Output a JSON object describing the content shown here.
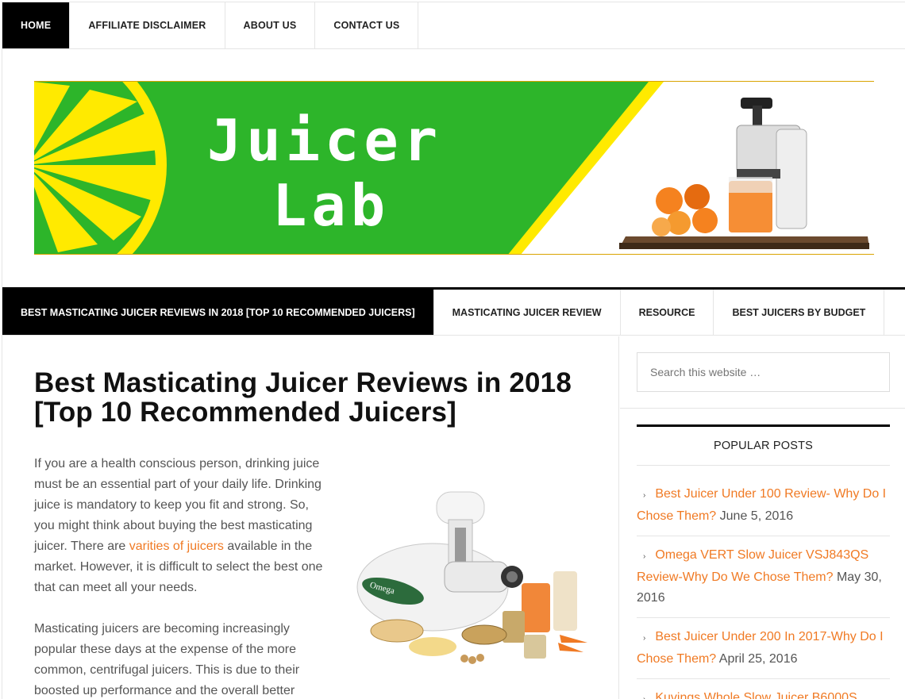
{
  "top_nav": [
    {
      "label": "HOME",
      "active": true
    },
    {
      "label": "AFFILIATE DISCLAIMER",
      "active": false
    },
    {
      "label": "ABOUT US",
      "active": false
    },
    {
      "label": "CONTACT US",
      "active": false
    }
  ],
  "banner": {
    "word1": "Juicer",
    "word2": "Lab",
    "colors": {
      "green": "#2db52a",
      "yellow": "#ffea00",
      "orange": "#f5821f"
    }
  },
  "sub_nav": [
    {
      "label": "BEST MASTICATING JUICER REVIEWS IN 2018 [TOP 10 RECOMMENDED JUICERS]",
      "active": true
    },
    {
      "label": "MASTICATING JUICER REVIEW",
      "active": false
    },
    {
      "label": "RESOURCE",
      "active": false
    },
    {
      "label": "BEST JUICERS BY BUDGET",
      "active": false
    }
  ],
  "article": {
    "title_line1": "Best Masticating Juicer Reviews in 2018",
    "title_line2": "[Top 10 Recommended Juicers]",
    "p1_before": "If you are a health conscious person, drinking juice must be an essential part of your daily life. Drinking juice is mandatory to keep you fit and strong. So, you might think about buying the best masticating juicer. There are ",
    "p1_link": "varities of juicers",
    "p1_after": " available in the market. However, it is difficult to select the best one that can meet all your needs.",
    "p2": "Masticating juicers are becoming increasingly popular these days at the expense of the more common, centrifugal juicers. This is due to their boosted up performance and the overall better",
    "image_alt": "Omega juicer",
    "brand_text": "Omega"
  },
  "sidebar": {
    "search_placeholder": "Search this website …",
    "widget_title": "POPULAR POSTS",
    "posts": [
      {
        "link": "Best Juicer Under 100 Review- Why Do I Chose Them?",
        "date": "June 5, 2016"
      },
      {
        "link": "Omega VERT Slow Juicer VSJ843QS Review-Why Do We Chose Them?",
        "date": "May 30, 2016"
      },
      {
        "link": "Best Juicer Under 200 In 2017-Why Do I Chose Them?",
        "date": "April 25, 2016"
      },
      {
        "link": "Kuvings Whole Slow Juicer B6000S",
        "date": ""
      }
    ]
  },
  "icons": {
    "post_bullet": "chevron-right-icon"
  },
  "colors": {
    "accent": "#f07a24",
    "nav_active_bg": "#000000",
    "text": "#555555"
  }
}
